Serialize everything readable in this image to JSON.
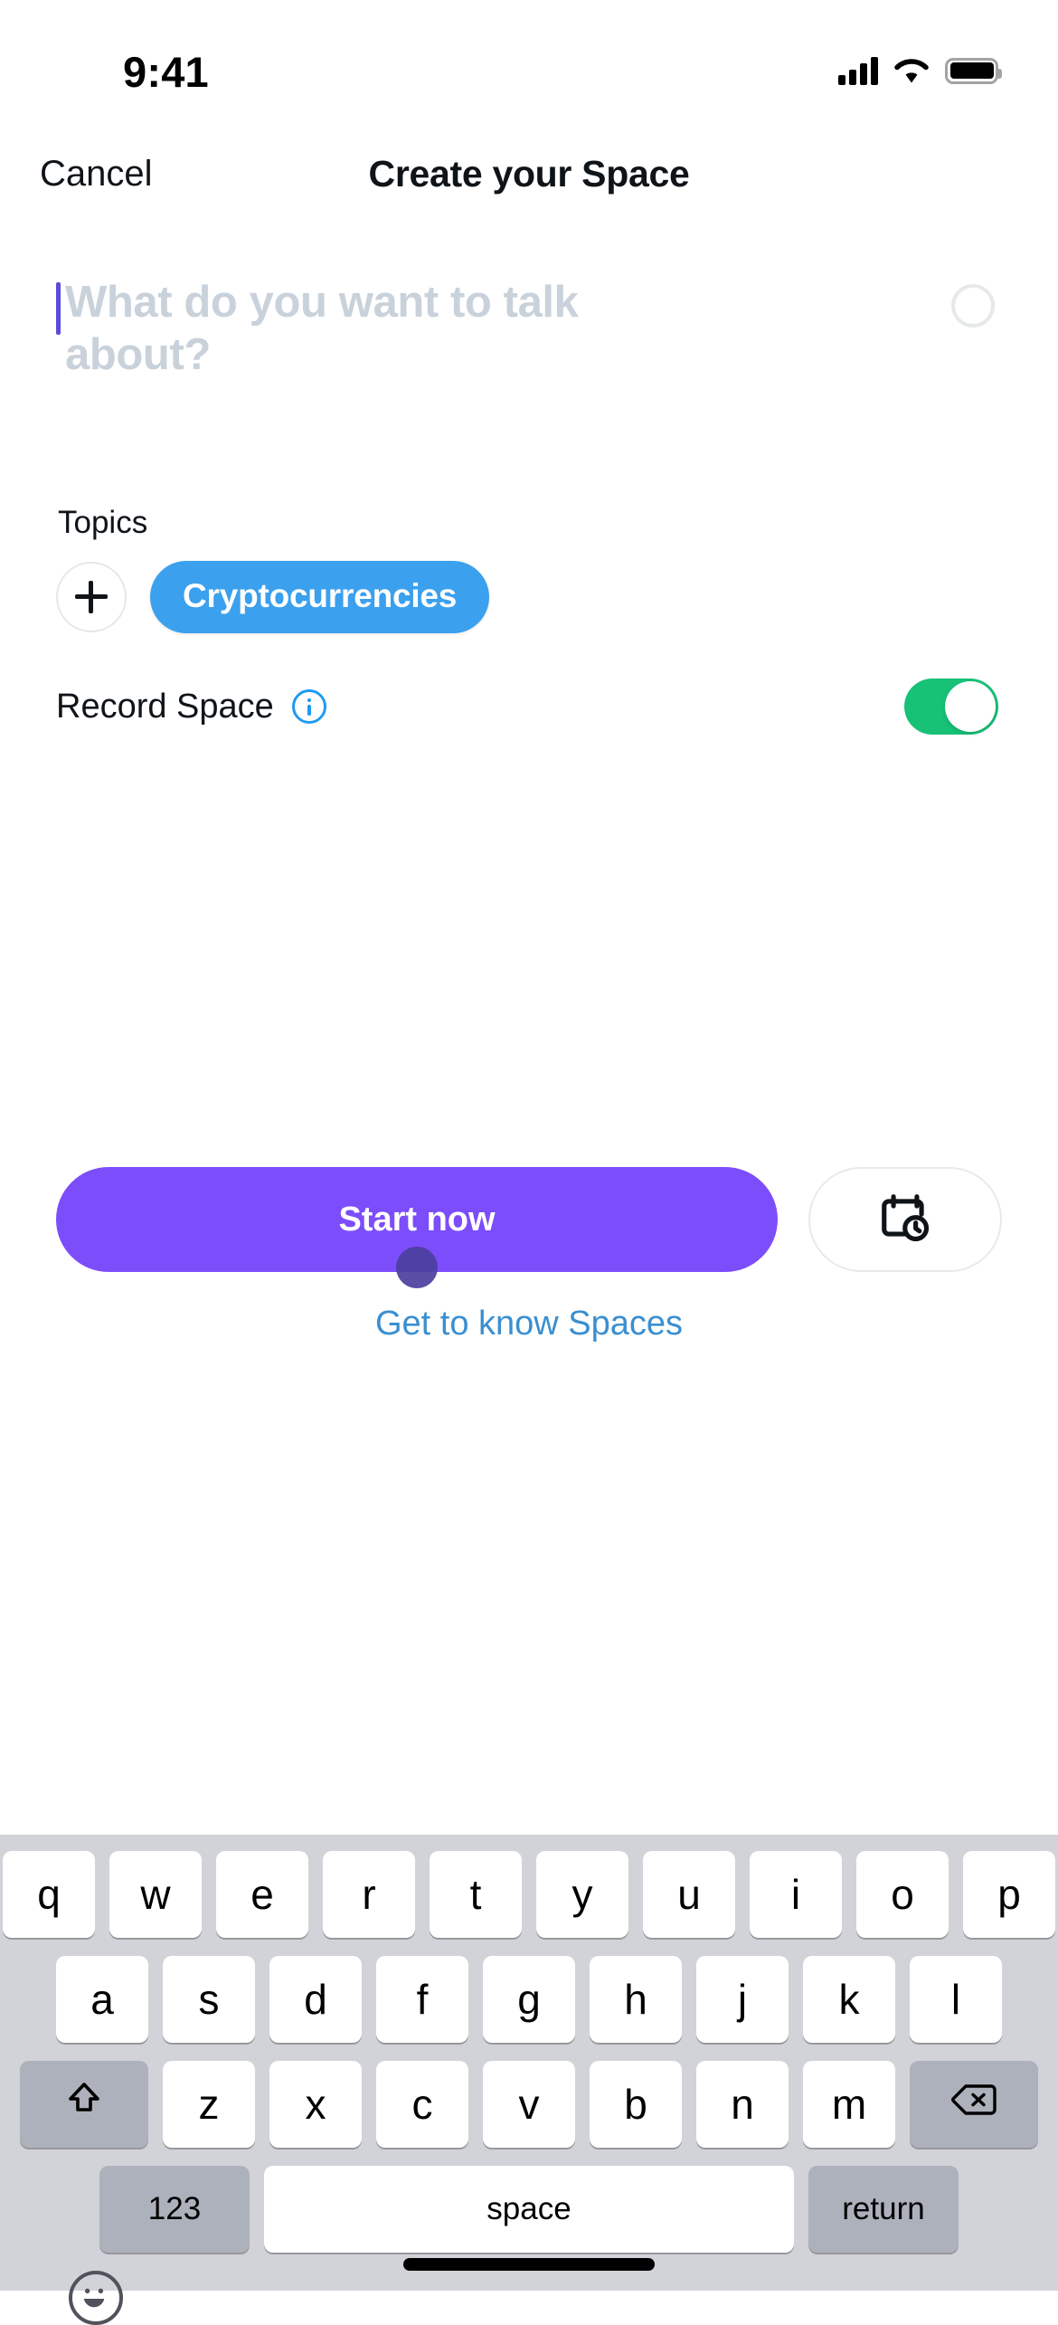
{
  "status_bar": {
    "time": "9:41",
    "cellular_icon": "signal-bars-icon",
    "wifi_icon": "wifi-icon",
    "battery_icon": "battery-icon"
  },
  "nav": {
    "cancel_label": "Cancel",
    "title": "Create your Space"
  },
  "composer": {
    "placeholder": "What do you want to talk about?",
    "value": "",
    "char_ring": "character-count-ring"
  },
  "topics": {
    "label": "Topics",
    "add_icon": "plus-icon",
    "chips": [
      {
        "label": "Cryptocurrencies",
        "color": "#3ba0ed"
      }
    ]
  },
  "record": {
    "label": "Record Space",
    "info_icon": "info-circle-icon",
    "toggle_state": "on",
    "toggle_color": "#17c176"
  },
  "actions": {
    "start_label": "Start now",
    "start_color": "#7c4dfa",
    "schedule_icon": "calendar-clock-icon",
    "link_label": "Get to know Spaces",
    "link_color": "#3a8fd0"
  },
  "keyboard": {
    "row1": [
      "q",
      "w",
      "e",
      "r",
      "t",
      "y",
      "u",
      "i",
      "o",
      "p"
    ],
    "row2": [
      "a",
      "s",
      "d",
      "f",
      "g",
      "h",
      "j",
      "k",
      "l"
    ],
    "row3": [
      "z",
      "x",
      "c",
      "v",
      "b",
      "n",
      "m"
    ],
    "shift_icon": "shift-arrow-icon",
    "backspace_icon": "backspace-icon",
    "numbers_label": "123",
    "space_label": "space",
    "return_label": "return",
    "emoji_icon": "emoji-smiley-icon"
  }
}
